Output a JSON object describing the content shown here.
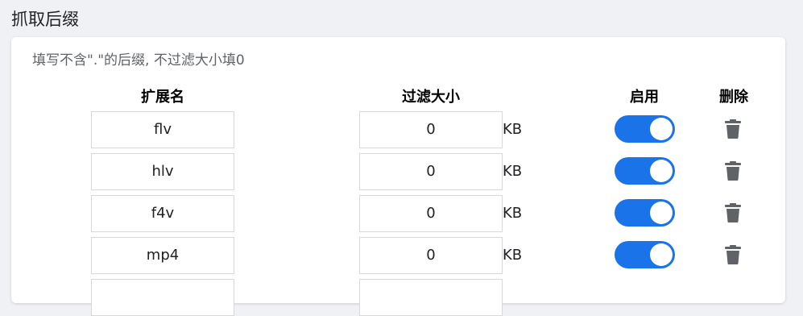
{
  "section": {
    "title": "抓取后缀"
  },
  "card": {
    "hint": "填写不含\".\"的后缀, 不过滤大小填0",
    "headers": {
      "extension": "扩展名",
      "filter_size": "过滤大小",
      "enable": "启用",
      "delete": "删除"
    },
    "rows": [
      {
        "extension": "flv",
        "size": "0",
        "unit": "KB",
        "enabled": true
      },
      {
        "extension": "hlv",
        "size": "0",
        "unit": "KB",
        "enabled": true
      },
      {
        "extension": "f4v",
        "size": "0",
        "unit": "KB",
        "enabled": true
      },
      {
        "extension": "mp4",
        "size": "0",
        "unit": "KB",
        "enabled": true
      },
      {
        "extension": "",
        "size": "",
        "unit": "",
        "enabled": true
      }
    ]
  },
  "colors": {
    "accent": "#1a73e8",
    "trash": "#5f6368"
  },
  "icons": {
    "delete": "trash-icon"
  }
}
